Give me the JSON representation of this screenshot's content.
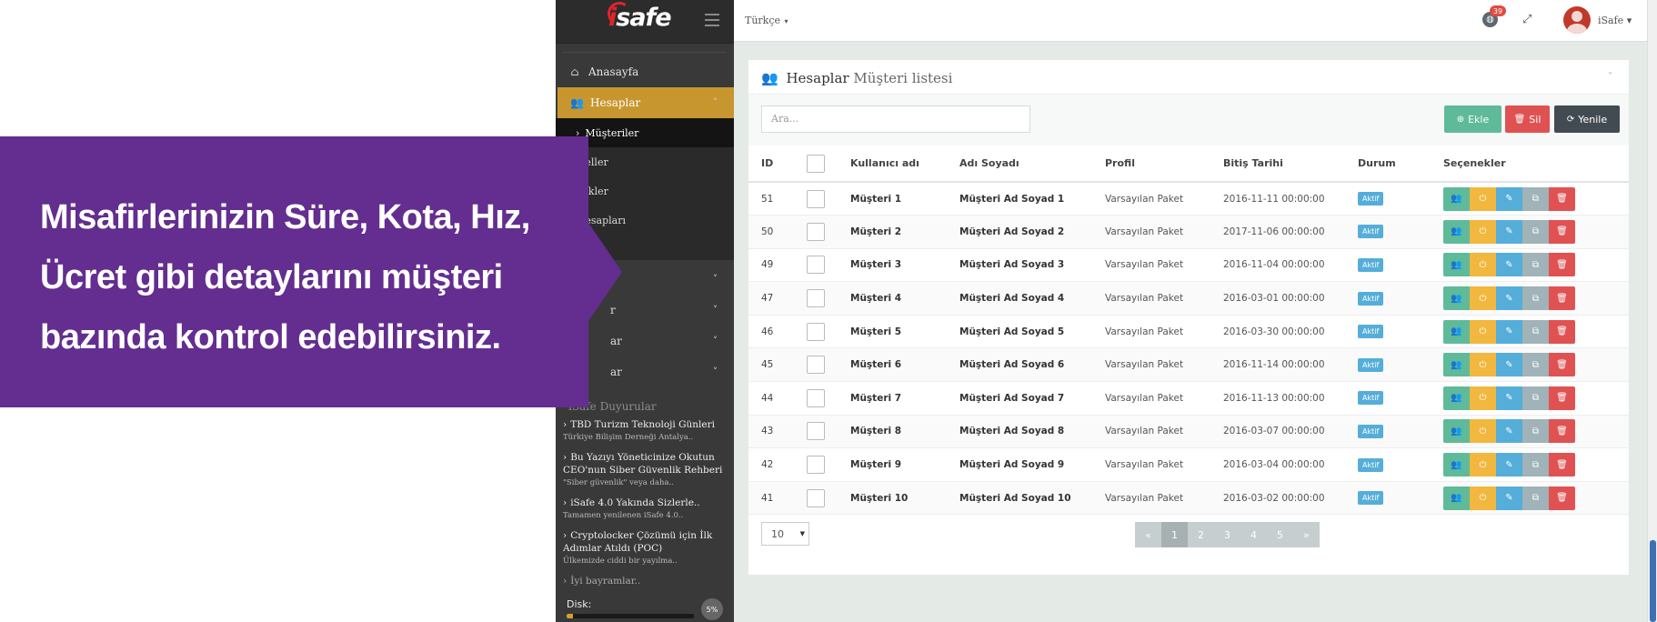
{
  "callout": {
    "line1": "Misafirlerinizin Süre, Kota, Hız,",
    "line2": "Ücret gibi detaylarını müşteri",
    "line3": "bazında kontrol edebilirsiniz."
  },
  "brand": {
    "logo_prefix": "i",
    "logo_rest": "safe"
  },
  "sidebar": {
    "home_label": "Anasayfa",
    "accounts_label": "Hesaplar",
    "sub_items": [
      {
        "label": "Müşteriler"
      },
      {
        "label": "eller"
      },
      {
        "label": "ikler"
      },
      {
        "label": "esapları"
      }
    ],
    "collapsed_items": [
      {
        "label": ""
      },
      {
        "label": "r"
      },
      {
        "label": "ar"
      },
      {
        "label": "ar"
      }
    ],
    "news_title": "iSafe Duyurular",
    "news": [
      {
        "title": "TBD Turizm Teknoloji Günleri",
        "summary": "Türkiye Bilişim Derneği Antalya.."
      },
      {
        "title": "Bu Yazıyı Yöneticinize Okutun CEO'nun Siber Güvenlik Rehberi",
        "summary": "\"Siber güvenlik\" veya daha.."
      },
      {
        "title": "iSafe 4.0 Yakında Sizlerle..",
        "summary": "Tamamen yenilenen iSafe 4.0.."
      },
      {
        "title": "Cryptolocker Çözümü için İlk Adımlar Atıldı (POC)",
        "summary": "Ülkemizde ciddi bir yayılma.."
      },
      {
        "title": "İyi bayramlar..",
        "summary": ""
      }
    ],
    "disk_label": "Disk:",
    "disk_percent_text": "5%",
    "disk_fraction": 0.05
  },
  "topbar": {
    "language": "Türkçe",
    "notifications_count": "39",
    "username": "iSafe"
  },
  "panel": {
    "title_main": "Hesaplar",
    "title_sub": "Müşteri listesi",
    "search_placeholder": "Ara...",
    "add_label": "Ekle",
    "delete_label": "Sil",
    "refresh_label": "Yenile"
  },
  "table": {
    "headers": {
      "id": "ID",
      "username": "Kullanıcı adı",
      "fullname": "Adı Soyadı",
      "profile": "Profil",
      "end_date": "Bitiş Tarihi",
      "status": "Durum",
      "options": "Seçenekler"
    },
    "rows": [
      {
        "id": "51",
        "username": "Müşteri 1",
        "fullname": "Müşteri Ad Soyad 1",
        "profile": "Varsayılan Paket",
        "end_date": "2016-11-11 00:00:00",
        "status": "Aktif"
      },
      {
        "id": "50",
        "username": "Müşteri 2",
        "fullname": "Müşteri Ad Soyad 2",
        "profile": "Varsayılan Paket",
        "end_date": "2017-11-06 00:00:00",
        "status": "Aktif"
      },
      {
        "id": "49",
        "username": "Müşteri 3",
        "fullname": "Müşteri Ad Soyad 3",
        "profile": "Varsayılan Paket",
        "end_date": "2016-11-04 00:00:00",
        "status": "Aktif"
      },
      {
        "id": "47",
        "username": "Müşteri 4",
        "fullname": "Müşteri Ad Soyad 4",
        "profile": "Varsayılan Paket",
        "end_date": "2016-03-01 00:00:00",
        "status": "Aktif"
      },
      {
        "id": "46",
        "username": "Müşteri 5",
        "fullname": "Müşteri Ad Soyad 5",
        "profile": "Varsayılan Paket",
        "end_date": "2016-03-30 00:00:00",
        "status": "Aktif"
      },
      {
        "id": "45",
        "username": "Müşteri 6",
        "fullname": "Müşteri Ad Soyad 6",
        "profile": "Varsayılan Paket",
        "end_date": "2016-11-14 00:00:00",
        "status": "Aktif"
      },
      {
        "id": "44",
        "username": "Müşteri 7",
        "fullname": "Müşteri Ad Soyad 7",
        "profile": "Varsayılan Paket",
        "end_date": "2016-11-13 00:00:00",
        "status": "Aktif"
      },
      {
        "id": "43",
        "username": "Müşteri 8",
        "fullname": "Müşteri Ad Soyad 8",
        "profile": "Varsayılan Paket",
        "end_date": "2016-03-07 00:00:00",
        "status": "Aktif"
      },
      {
        "id": "42",
        "username": "Müşteri 9",
        "fullname": "Müşteri Ad Soyad 9",
        "profile": "Varsayılan Paket",
        "end_date": "2016-03-04 00:00:00",
        "status": "Aktif"
      },
      {
        "id": "41",
        "username": "Müşteri 10",
        "fullname": "Müşteri Ad Soyad 10",
        "profile": "Varsayılan Paket",
        "end_date": "2016-03-02 00:00:00",
        "status": "Aktif"
      }
    ],
    "row_action_icons": [
      "users-icon",
      "power-icon",
      "edit-icon",
      "copy-icon",
      "trash-icon"
    ]
  },
  "footer": {
    "page_size": "10",
    "pager": [
      "«",
      "1",
      "2",
      "3",
      "4",
      "5",
      "»"
    ],
    "current_page": "1"
  },
  "colors": {
    "callout": "#632e8f",
    "sidebar": "#393939",
    "accent_gold": "#c8962e",
    "green": "#5fba9a",
    "red": "#e05252",
    "blue": "#55aed9",
    "yellow": "#f1b73e"
  }
}
